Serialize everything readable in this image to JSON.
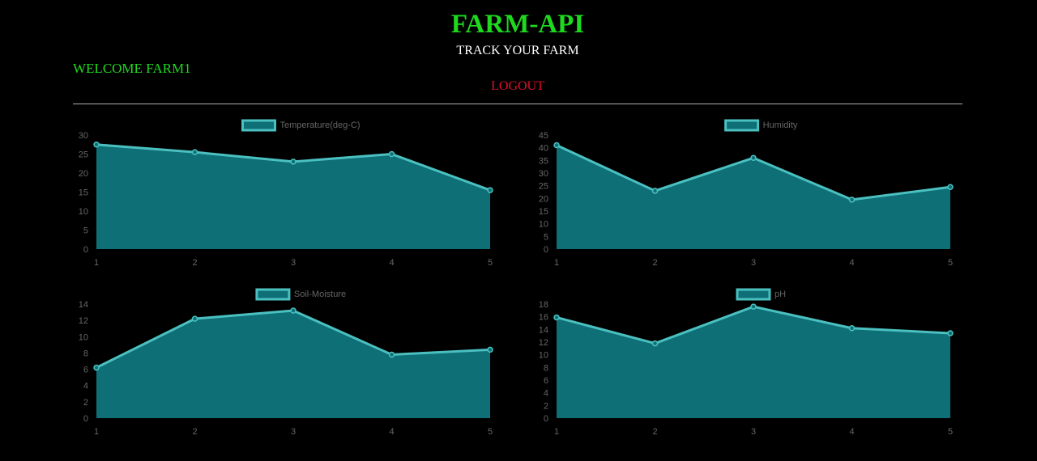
{
  "header": {
    "title": "FARM-API",
    "subtitle": "TRACK YOUR FARM",
    "welcome": "WELCOME FARM1",
    "logout_label": "LOGOUT"
  },
  "colors": {
    "title": "#1ed91e",
    "welcome": "#1ed91e",
    "logout": "#e0102a",
    "series_line": "#4bc0c0",
    "series_fill": "#0f6f76"
  },
  "chart_data": [
    {
      "type": "area",
      "legend": "Temperature(deg-C)",
      "x": [
        "1",
        "2",
        "3",
        "4",
        "5"
      ],
      "values": [
        27.5,
        25.5,
        23,
        25,
        15.5
      ],
      "ylim": [
        0,
        30
      ],
      "yticks": [
        0,
        5,
        10,
        15,
        20,
        25,
        30
      ],
      "legend_position": "top",
      "grid": false
    },
    {
      "type": "area",
      "legend": "Humidity",
      "x": [
        "1",
        "2",
        "3",
        "4",
        "5"
      ],
      "values": [
        41,
        23,
        36,
        19.5,
        24.5
      ],
      "ylim": [
        0,
        45
      ],
      "yticks": [
        0,
        5,
        10,
        15,
        20,
        25,
        30,
        35,
        40,
        45
      ],
      "legend_position": "top",
      "grid": false
    },
    {
      "type": "area",
      "legend": "Soil-Moisture",
      "x": [
        "1",
        "2",
        "3",
        "4",
        "5"
      ],
      "values": [
        6.2,
        12.2,
        13.2,
        7.8,
        8.4
      ],
      "ylim": [
        0,
        14
      ],
      "yticks": [
        0,
        2,
        4,
        6,
        8,
        10,
        12,
        14
      ],
      "legend_position": "top",
      "grid": false
    },
    {
      "type": "area",
      "legend": "pH",
      "x": [
        "1",
        "2",
        "3",
        "4",
        "5"
      ],
      "values": [
        15.9,
        11.8,
        17.6,
        14.2,
        13.4
      ],
      "ylim": [
        0,
        18
      ],
      "yticks": [
        0,
        2,
        4,
        6,
        8,
        10,
        12,
        14,
        16,
        18
      ],
      "legend_position": "top",
      "grid": false
    }
  ]
}
